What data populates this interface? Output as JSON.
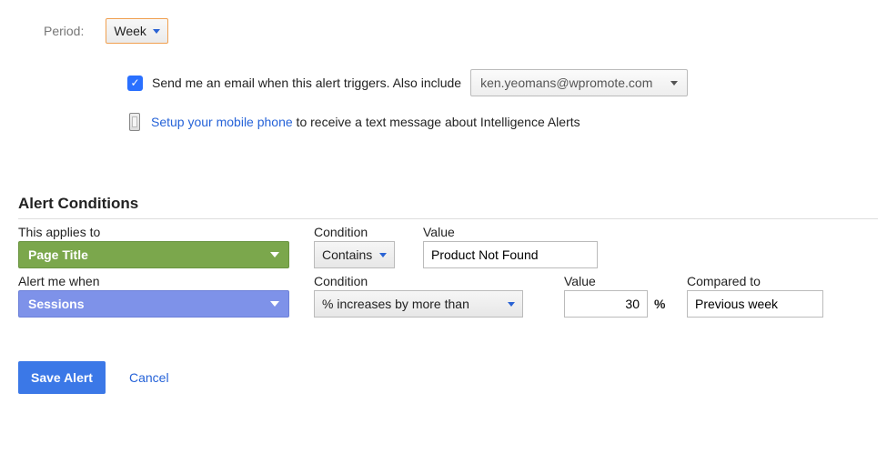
{
  "period": {
    "label": "Period:",
    "value": "Week"
  },
  "email": {
    "checked": true,
    "text": "Send me an email when this alert triggers. Also include",
    "selected_email": "ken.yeomans@wpromote.com"
  },
  "mobile": {
    "link_text": "Setup your mobile phone",
    "suffix_text": " to receive a text message about Intelligence Alerts"
  },
  "section_header": "Alert Conditions",
  "applies": {
    "label": "This applies to",
    "dimension": "Page Title",
    "condition_label": "Condition",
    "condition_value": "Contains",
    "value_label": "Value",
    "value_input": "Product Not Found"
  },
  "alert": {
    "label": "Alert me when",
    "metric": "Sessions",
    "condition_label": "Condition",
    "condition_value": "% increases by more than",
    "value_label": "Value",
    "value_input": "30",
    "percent": "%",
    "compared_label": "Compared to",
    "compared_value": "Previous week"
  },
  "footer": {
    "save": "Save Alert",
    "cancel": "Cancel"
  }
}
